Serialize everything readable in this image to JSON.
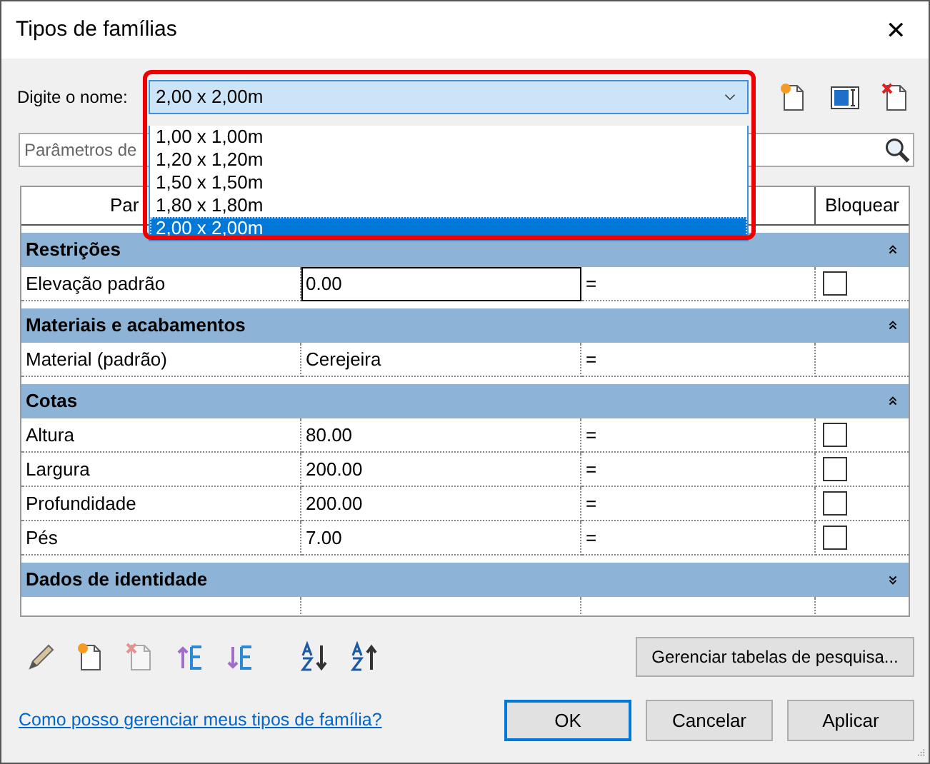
{
  "window": {
    "title": "Tipos de famílias",
    "close": "✕"
  },
  "name_field": {
    "label": "Digite o nome:",
    "value": "2,00 x 2,00m",
    "options": [
      {
        "label": "1,00 x 1,00m",
        "selected": false
      },
      {
        "label": "1,20 x 1,20m",
        "selected": false
      },
      {
        "label": "1,50 x 1,50m",
        "selected": false
      },
      {
        "label": "1,80 x 1,80m",
        "selected": false
      },
      {
        "label": "2,00 x 2,00m",
        "selected": true
      }
    ]
  },
  "search": {
    "placeholder": "Parâmetros de"
  },
  "table": {
    "columns": [
      "Par",
      "Bloquear"
    ],
    "rows": [
      {
        "kind": "group",
        "label": "Restrições",
        "expanded": true
      },
      {
        "kind": "param",
        "name": "Elevação padrão",
        "value": "0.00",
        "formula": "=",
        "editing": true,
        "lock": {
          "checked": false
        }
      },
      {
        "kind": "group",
        "label": "Materiais e acabamentos",
        "expanded": true
      },
      {
        "kind": "param",
        "name": "Material (padrão)",
        "value": "Cerejeira",
        "formula": "=",
        "editing": false
      },
      {
        "kind": "group",
        "label": "Cotas",
        "expanded": true
      },
      {
        "kind": "param",
        "name": "Altura",
        "value": "80.00",
        "formula": "=",
        "editing": false,
        "lock": {
          "checked": false
        }
      },
      {
        "kind": "param",
        "name": "Largura",
        "value": "200.00",
        "formula": "=",
        "editing": false,
        "lock": {
          "checked": false
        }
      },
      {
        "kind": "param",
        "name": "Profundidade",
        "value": "200.00",
        "formula": "=",
        "editing": false,
        "lock": {
          "checked": false
        }
      },
      {
        "kind": "param",
        "name": "Pés",
        "value": "7.00",
        "formula": "=",
        "editing": false,
        "lock": {
          "checked": false
        }
      },
      {
        "kind": "group",
        "label": "Dados de identidade",
        "expanded": false
      },
      {
        "kind": "blank"
      }
    ]
  },
  "lookup_button": "Gerenciar tabelas de pesquisa...",
  "help_link": "Como posso gerenciar meus tipos de família?",
  "buttons": [
    {
      "label": "OK",
      "default": true
    },
    {
      "label": "Cancelar",
      "default": false
    },
    {
      "label": "Aplicar",
      "default": false
    }
  ]
}
